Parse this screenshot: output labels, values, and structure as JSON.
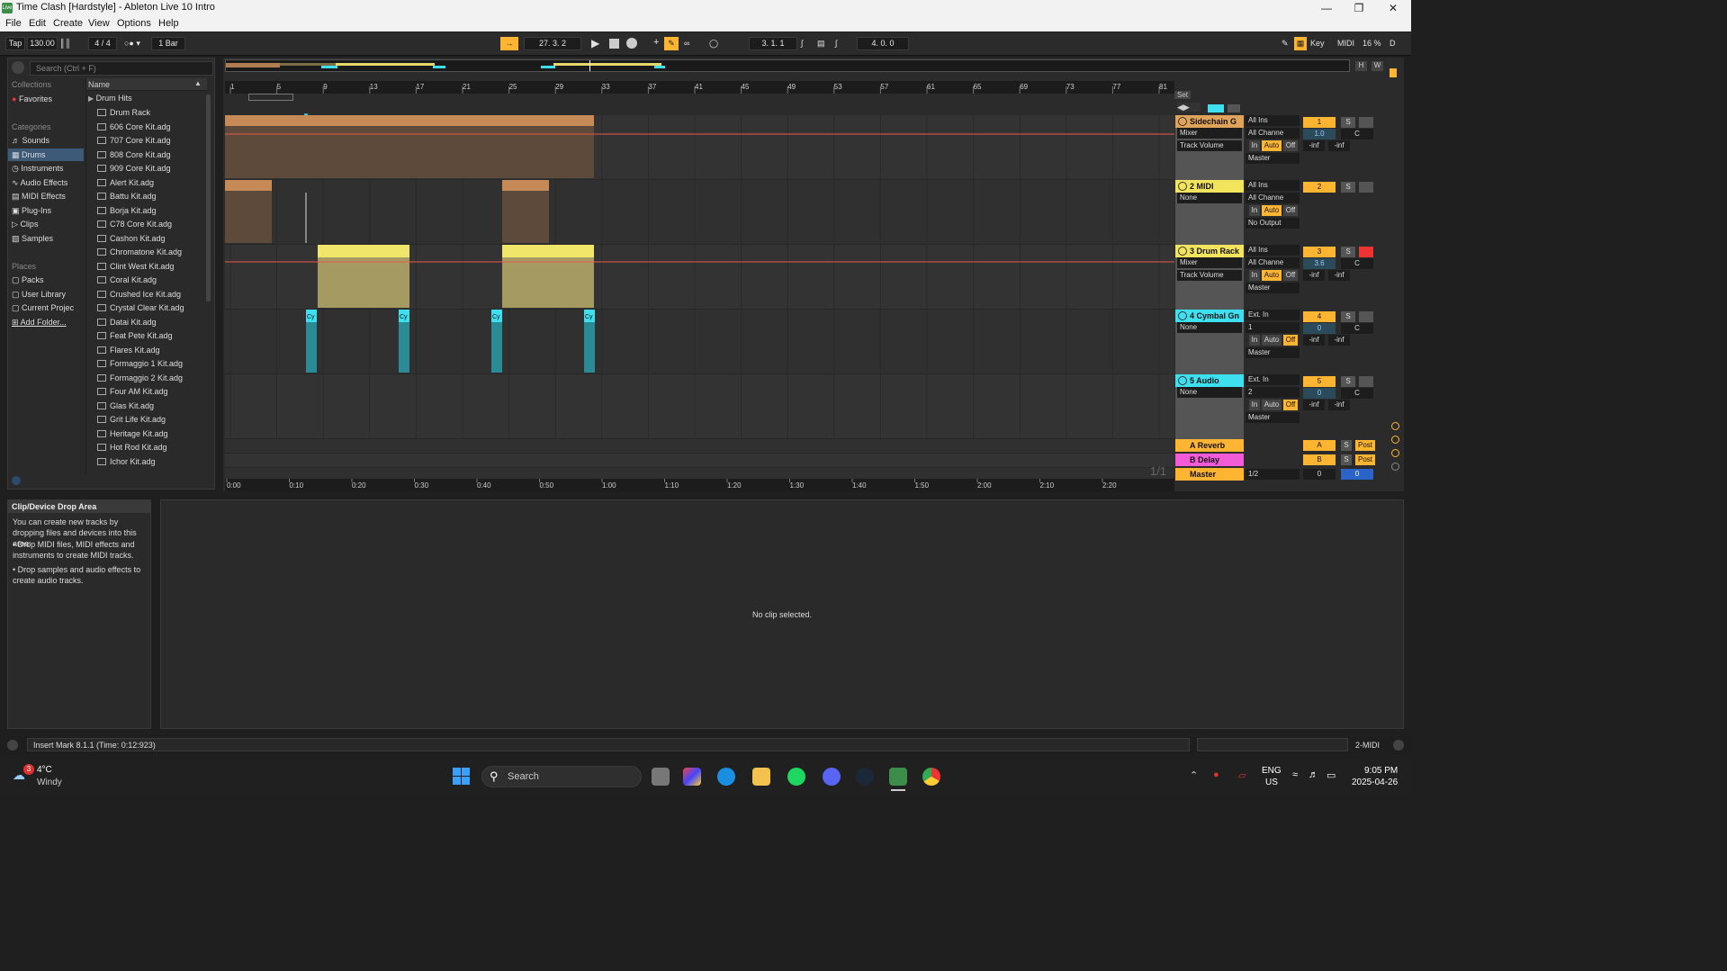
{
  "window": {
    "title": "Time Clash  [Hardstyle] - Ableton Live 10 Intro",
    "icon": "Live"
  },
  "menu": [
    "File",
    "Edit",
    "Create",
    "View",
    "Options",
    "Help"
  ],
  "control": {
    "tap": "Tap",
    "tempo": "130.00",
    "sig": "4 / 4",
    "quant": "1 Bar",
    "position": "27.   3.   2",
    "loop_start": "3.   1.   1",
    "loop_len": "4.   0.   0",
    "key": "Key",
    "midi": "MIDI",
    "cpu": "16 %",
    "d": "D"
  },
  "browser": {
    "search_placeholder": "Search (Ctrl + F)",
    "collections_header": "Collections",
    "favorites": "Favorites",
    "categories_header": "Categories",
    "categories": [
      "Sounds",
      "Drums",
      "Instruments",
      "Audio Effects",
      "MIDI Effects",
      "Plug-Ins",
      "Clips",
      "Samples"
    ],
    "places_header": "Places",
    "places": [
      "Packs",
      "User Library",
      "Current Projec",
      "Add Folder..."
    ],
    "name_header": "Name",
    "folder": "Drum Hits",
    "files": [
      "Drum Rack",
      "606 Core Kit.adg",
      "707 Core Kit.adg",
      "808 Core Kit.adg",
      "909 Core Kit.adg",
      "Alert Kit.adg",
      "Battu Kit.adg",
      "Borja Kit.adg",
      "C78 Core Kit.adg",
      "Cashon Kit.adg",
      "Chromatone Kit.adg",
      "Clint West Kit.adg",
      "Coral Kit.adg",
      "Crushed Ice Kit.adg",
      "Crystal Clear Kit.adg",
      "Datai Kit.adg",
      "Feat Pete Kit.adg",
      "Flares Kit.adg",
      "Formaggio 1 Kit.adg",
      "Formaggio 2 Kit.adg",
      "Four AM Kit.adg",
      "Glas Kit.adg",
      "Grit Life Kit.adg",
      "Heritage Kit.adg",
      "Hot Rod Kit.adg",
      "Ichor Kit.adg"
    ]
  },
  "ruler": [
    "1",
    "5",
    "9",
    "13",
    "17",
    "21",
    "25",
    "29",
    "33",
    "37",
    "41",
    "45",
    "49",
    "53",
    "57",
    "61",
    "65",
    "69",
    "73",
    "77",
    "81"
  ],
  "time_ruler": [
    "0:00",
    "0:10",
    "0:20",
    "0:30",
    "0:40",
    "0:50",
    "1:00",
    "1:10",
    "1:20",
    "1:30",
    "1:40",
    "1:50",
    "2:00",
    "2:10",
    "2:20"
  ],
  "set_label": "Set",
  "tracks": [
    {
      "name": "Sidechain G",
      "color": "#e0a35a",
      "in": "All Ins",
      "ch": "All Channe",
      "dev": "Mixer",
      "param": "Track Volume",
      "num": "1",
      "vol": "1.0",
      "pan": "C",
      "out": "Master",
      "monitor": [
        "In",
        "Auto",
        "Off"
      ],
      "meters": [
        "-inf",
        "-inf"
      ],
      "s": "S"
    },
    {
      "name": "2 MIDI",
      "color": "#f2e45d",
      "in": "All Ins",
      "ch": "All Channe",
      "dev": "None",
      "num": "2",
      "out": "No Output",
      "monitor": [
        "In",
        "Auto",
        "Off"
      ],
      "s": "S"
    },
    {
      "name": "3 Drum Rack",
      "color": "#f2e45d",
      "in": "All Ins",
      "ch": "All Channe",
      "dev": "Mixer",
      "param": "Track Volume",
      "num": "3",
      "vol": "3.6",
      "pan": "C",
      "out": "Master",
      "monitor": [
        "In",
        "Auto",
        "Off"
      ],
      "meters": [
        "-inf",
        "-inf"
      ],
      "s": "S"
    },
    {
      "name": "4 Cymbal Gn",
      "color": "#3ee0f0",
      "in": "Ext. In",
      "ch": "1",
      "dev": "None",
      "num": "4",
      "vol": "0",
      "pan": "C",
      "out": "Master",
      "monitor": [
        "In",
        "Auto",
        "Off"
      ],
      "meters": [
        "-inf",
        "-inf"
      ],
      "s": "S"
    },
    {
      "name": "5 Audio",
      "color": "#3ee0f0",
      "in": "Ext. In",
      "ch": "2",
      "dev": "None",
      "num": "5",
      "vol": "0",
      "pan": "C",
      "out": "Master",
      "monitor": [
        "In",
        "Auto",
        "Off"
      ],
      "meters": [
        "-inf",
        "-inf"
      ],
      "s": "S"
    }
  ],
  "returns": [
    {
      "name": "A Reverb",
      "color": "#ffb531",
      "num": "A",
      "s": "S",
      "post": "Post"
    },
    {
      "name": "B Delay",
      "color": "#f25ad8",
      "num": "B",
      "s": "S",
      "post": "Post"
    }
  ],
  "master": {
    "name": "Master",
    "color": "#ffb531",
    "quant": "1/2",
    "vol": "0",
    "pan": "0",
    "ratio": "1/1"
  },
  "clip_label": "Cy",
  "detail": {
    "title": "Clip/Device Drop Area",
    "text": "You can create new tracks by dropping files and devices into this area:",
    "bullets": [
      "Drop MIDI files, MIDI effects and instruments to create MIDI tracks.",
      "Drop samples and audio effects to create audio tracks."
    ]
  },
  "clipview": {
    "message": "No clip selected."
  },
  "status": {
    "text": "Insert Mark 8.1.1 (Time: 0:12:923)",
    "track": "2-MIDI"
  },
  "taskbar": {
    "weather_temp": "4°C",
    "weather_desc": "Windy",
    "weather_badge": "3",
    "search": "Search",
    "lang1": "ENG",
    "lang2": "US",
    "time": "9:05 PM",
    "date": "2025-04-26"
  }
}
